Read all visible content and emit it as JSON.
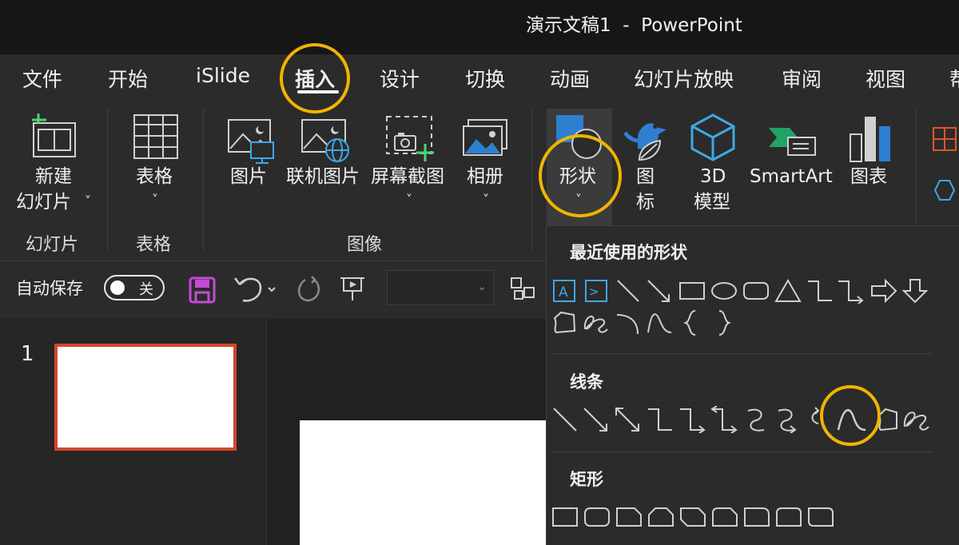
{
  "window": {
    "title": "演示文稿1  -  PowerPoint"
  },
  "menu": {
    "tabs": [
      {
        "label": "文件"
      },
      {
        "label": "开始"
      },
      {
        "label": "iSlide"
      },
      {
        "label": "插入",
        "active": true
      },
      {
        "label": "设计"
      },
      {
        "label": "切换"
      },
      {
        "label": "动画"
      },
      {
        "label": "幻灯片放映"
      },
      {
        "label": "审阅"
      },
      {
        "label": "视图"
      },
      {
        "label": "帮"
      }
    ]
  },
  "ribbon": {
    "new_slide": {
      "line1": "新建",
      "line2": "幻灯片",
      "chevron": "˅"
    },
    "table": {
      "label": "表格",
      "chevron": "˅"
    },
    "picture": {
      "label": "图片"
    },
    "online_picture": {
      "label": "联机图片"
    },
    "screenshot": {
      "label": "屏幕截图",
      "chevron": "˅"
    },
    "album": {
      "label": "相册",
      "chevron": "˅"
    },
    "shapes": {
      "label": "形状",
      "chevron": "˅"
    },
    "icons": {
      "line1": "图",
      "line2": "标"
    },
    "model3d": {
      "line1": "3D",
      "line2": "模型"
    },
    "smartart": {
      "label": "SmartArt"
    },
    "chart": {
      "label": "图表"
    },
    "groups": {
      "slides": "幻灯片",
      "tables": "表格",
      "images": "图像"
    }
  },
  "qat": {
    "autosave_label": "自动保存",
    "autosave_state": "关",
    "icons": [
      "save-icon",
      "undo-icon",
      "redo-icon",
      "present-icon",
      "arrange-icon"
    ]
  },
  "slides_pane": {
    "slide_number": "1"
  },
  "shapes_menu": {
    "recent_title": "最近使用的形状",
    "lines_title": "线条",
    "rect_title": "矩形"
  },
  "colors": {
    "accent_highlight": "#f0b400",
    "selected_slide_border": "#d2462b",
    "save_icon": "#c44bd6"
  }
}
